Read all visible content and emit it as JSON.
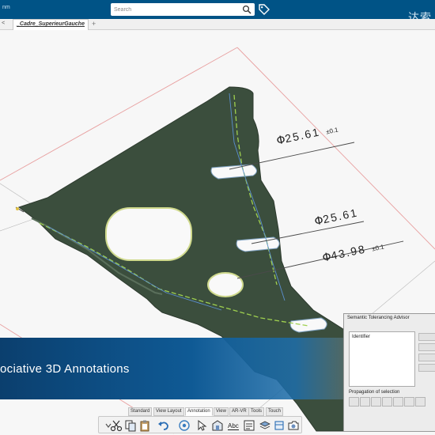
{
  "header": {
    "brand_fragment": "nm",
    "search_placeholder": "Search",
    "corner_text": "达索"
  },
  "tabs": {
    "prev_label": "<",
    "active_label": "_Cadre_SuperieurGauche",
    "add_label": "+"
  },
  "annotations": [
    {
      "symbol": "Φ",
      "value": "25.61",
      "tolerance": "±0.1"
    },
    {
      "symbol": "Φ",
      "value": "25.61",
      "tolerance": ""
    },
    {
      "symbol": "Φ",
      "value": "43.98",
      "tolerance": "±0.1"
    }
  ],
  "banner": {
    "text": "ociative 3D Annotations"
  },
  "advisor": {
    "title": "Semantic Tolerancing Advisor",
    "list_header": "Identifier",
    "propagation_label": "Propagation of selection"
  },
  "ribbon": {
    "tabs": [
      "Standard",
      "View Layout",
      "Annotation",
      "View",
      "AR-VR",
      "Tools",
      "Touch"
    ],
    "active_tab": "Annotation"
  },
  "toolbar": {
    "icons": [
      "cut-icon",
      "copy-icon",
      "paste-icon",
      "undo-icon",
      "view-icon",
      "pointer-icon",
      "drawing-icon",
      "text-icon",
      "datum-icon",
      "layer-icon",
      "sheet-icon",
      "capture-icon"
    ]
  },
  "colors": {
    "header_blue": "#005386",
    "part_green": "#3a4f3c",
    "banner_blue": "#0f5a95",
    "dim_line": "#4a4a4a"
  }
}
